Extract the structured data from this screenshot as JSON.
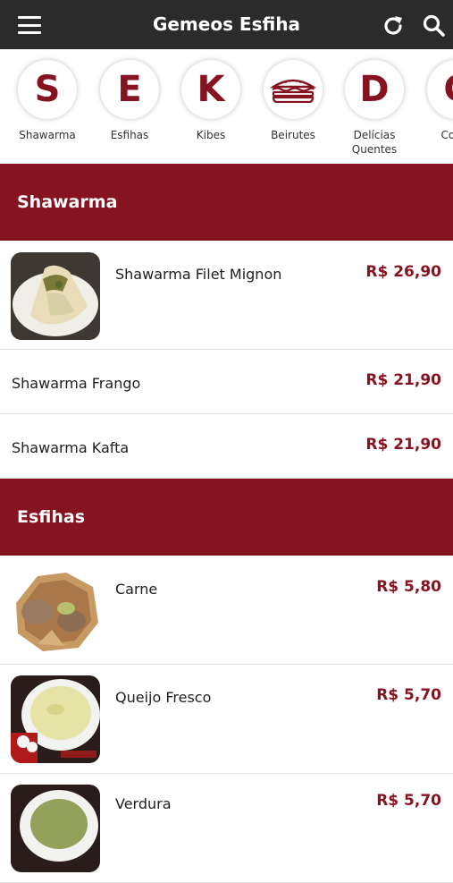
{
  "header": {
    "title": "Gemeos Esfiha",
    "menu_icon": "hamburger-menu-icon",
    "refresh_icon": "refresh-icon",
    "search_icon": "search-icon"
  },
  "categories": [
    {
      "letter": "S",
      "label": "Shawarma"
    },
    {
      "letter": "E",
      "label": "Esfihas"
    },
    {
      "letter": "K",
      "label": "Kibes"
    },
    {
      "letter": "",
      "icon": "sandwich-icon",
      "label": "Beirutes"
    },
    {
      "letter": "D",
      "label": "Delícias\nQuentes"
    },
    {
      "letter": "C",
      "label": "Comb"
    }
  ],
  "sections": [
    {
      "title": "Shawarma",
      "items": [
        {
          "name": "Shawarma Filet Mignon",
          "price": "R$ 26,90"
        },
        {
          "name": "Shawarma Frango",
          "price": "R$ 21,90"
        },
        {
          "name": "Shawarma Kafta",
          "price": "R$ 21,90"
        }
      ]
    },
    {
      "title": "Esfihas",
      "items": [
        {
          "name": "Carne",
          "price": "R$ 5,80"
        },
        {
          "name": "Queijo Fresco",
          "price": "R$ 5,70"
        },
        {
          "name": "Verdura",
          "price": "R$ 5,70"
        }
      ]
    }
  ],
  "colors": {
    "topbar": "#2b2b2b",
    "accent": "#861320"
  }
}
